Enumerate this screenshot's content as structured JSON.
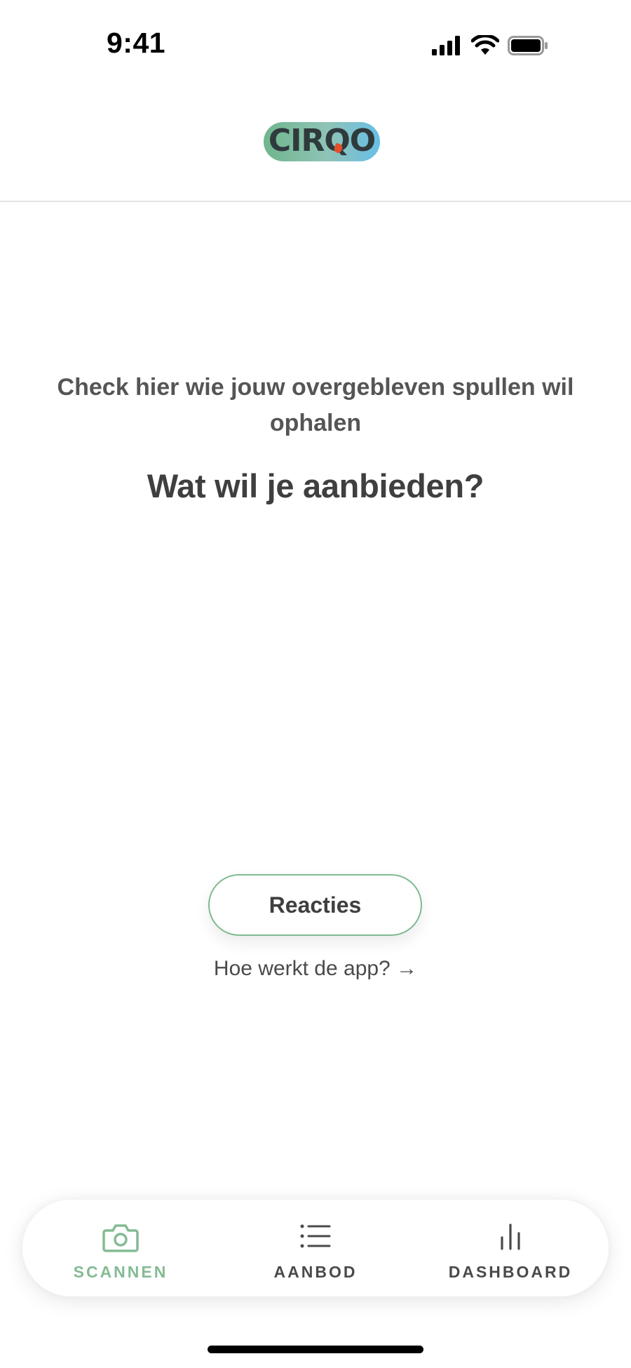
{
  "status_bar": {
    "time": "9:41"
  },
  "header": {
    "logo_text": "CIRQO"
  },
  "main": {
    "subtitle": "Check hier wie jouw overgebleven spullen wil ophalen",
    "headline": "Wat wil je aanbieden?",
    "reacties_label": "Reacties",
    "how_link": "Hoe werkt de app? →"
  },
  "bottom_nav": {
    "items": [
      {
        "label": "SCANNEN",
        "icon": "camera-icon",
        "active": true
      },
      {
        "label": "AANBOD",
        "icon": "list-icon",
        "active": false
      },
      {
        "label": "DASHBOARD",
        "icon": "bar-chart-icon",
        "active": false
      }
    ]
  },
  "colors": {
    "accent_green": "#84bb94",
    "button_border": "#7fba8f",
    "logo_gradient_start": "#6fb68d",
    "logo_gradient_end": "#68bfe6",
    "logo_dot": "#e3512a",
    "text_dark": "#3f3f3f"
  }
}
